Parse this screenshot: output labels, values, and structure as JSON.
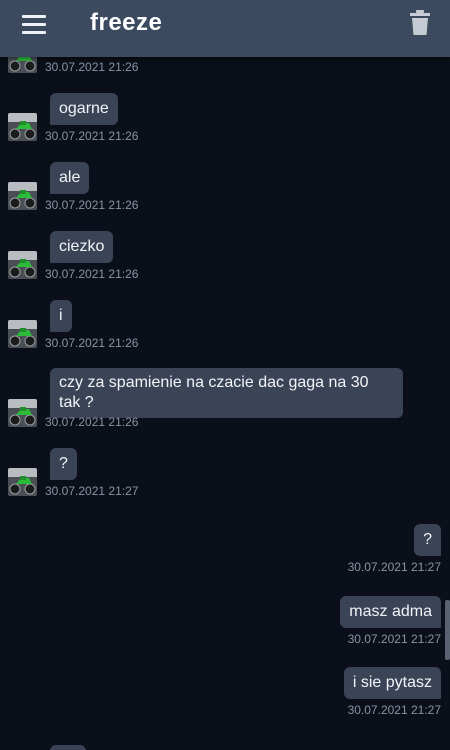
{
  "header": {
    "title": "freeze"
  },
  "icons": {
    "menu": "hamburger-menu-icon",
    "trash": "trash-icon",
    "avatar": "motorbike-avatar-image"
  },
  "colors": {
    "topbar": "#3c4a60",
    "background": "#0b0f19",
    "bubble": "#3b4357",
    "timestamp": "#8b93a1"
  },
  "messages": [
    {
      "side": "in",
      "text": "",
      "time": "30.07.2021 21:26"
    },
    {
      "side": "in",
      "text": "ogarne",
      "time": "30.07.2021 21:26"
    },
    {
      "side": "in",
      "text": "ale",
      "time": "30.07.2021 21:26"
    },
    {
      "side": "in",
      "text": "ciezko",
      "time": "30.07.2021 21:26"
    },
    {
      "side": "in",
      "text": "i",
      "time": "30.07.2021 21:26"
    },
    {
      "side": "in",
      "text": "czy za spamienie na czacie dac gaga na 30 tak ?",
      "time": "30.07.2021 21:26"
    },
    {
      "side": "in",
      "text": "?",
      "time": "30.07.2021 21:27"
    },
    {
      "side": "out",
      "text": "?",
      "time": "30.07.2021 21:27"
    },
    {
      "side": "out",
      "text": "masz adma",
      "time": "30.07.2021 21:27"
    },
    {
      "side": "out",
      "text": "i sie pytasz",
      "time": "30.07.2021 21:27"
    },
    {
      "side": "in",
      "text": "",
      "time": ""
    }
  ]
}
